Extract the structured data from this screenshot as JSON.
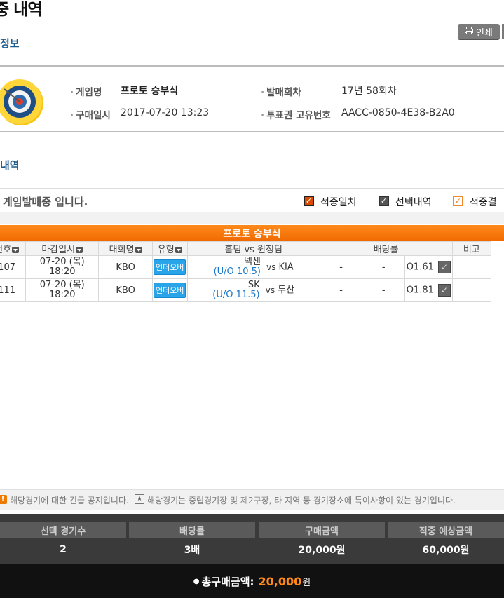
{
  "page": {
    "title": "중 내역",
    "print_label": "인쇄"
  },
  "info": {
    "section_title": "정보",
    "game_name_label": "게임명",
    "game_name": "프로토 승부식",
    "purchase_time_label": "구매일시",
    "purchase_time": "2017-07-20 13:23",
    "round_label": "발매회차",
    "round": "17년 58회차",
    "ticket_id_label": "투표권 고유번호",
    "ticket_id": "AACC-0850-4E38-B2A0"
  },
  "history": {
    "section_title": "내역",
    "status_text": "게임발매중 입니다.",
    "legend": {
      "hit": "적중일치",
      "selected": "선택내역",
      "result": "적중결고"
    },
    "table_title": "프로토 승부식",
    "columns": [
      "번호",
      "마감일시",
      "대회명",
      "유형",
      "홈팀 vs 원정팀",
      "배당률",
      "비고"
    ],
    "rows": [
      {
        "no": "107",
        "date": "07-20 (목)",
        "time": "18:20",
        "league": "KBO",
        "type": "언더오버",
        "home": "넥센",
        "uo": "(U/O 10.5)",
        "vs": "vs",
        "away": "KIA",
        "odd1": "-",
        "odd2": "-",
        "odd3": "O1.61"
      },
      {
        "no": "111",
        "date": "07-20 (목)",
        "time": "18:20",
        "league": "KBO",
        "type": "언더오버",
        "home": "SK",
        "uo": "(U/O 11.5)",
        "vs": "vs",
        "away": "두산",
        "odd1": "-",
        "odd2": "-",
        "odd3": "O1.81"
      }
    ]
  },
  "notices": {
    "urgent": "해당경기에 대한 긴급 공지입니다.",
    "neutral": "해당경기는 중립경기장 및 제2구장, 타 지역 등 경기장소에 특이사항이 있는 경기입니다."
  },
  "summary": {
    "headers": [
      "선택 경기수",
      "배당률",
      "구매금액",
      "적중 예상금액"
    ],
    "values": [
      "2",
      "3배",
      "20,000원",
      "60,000원"
    ],
    "total_label": "총구매금액:",
    "total_amount": "20,000",
    "total_unit": "원"
  },
  "colors": {
    "accent": "#f07a00",
    "section": "#1a5a8c",
    "badge": "#2aa4e8"
  },
  "icons": [
    "print-icon",
    "target-icon",
    "sort-icon",
    "check-icon",
    "warning-icon",
    "star-icon"
  ]
}
